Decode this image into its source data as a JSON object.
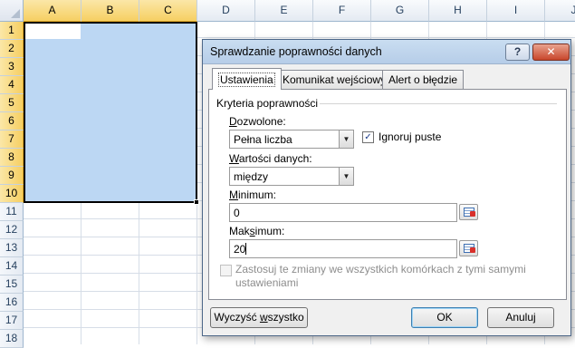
{
  "spreadsheet": {
    "columns": [
      "A",
      "B",
      "C",
      "D",
      "E",
      "F",
      "G",
      "H",
      "I",
      "J"
    ],
    "rows": [
      "1",
      "2",
      "3",
      "4",
      "5",
      "6",
      "7",
      "8",
      "9",
      "10",
      "11",
      "12",
      "13",
      "14",
      "15",
      "16",
      "17",
      "18"
    ],
    "selection_fill": "#bcd7f3"
  },
  "dialog": {
    "title": "Sprawdzanie poprawności danych",
    "help_label": "?",
    "close_label": "✕",
    "tabs": {
      "settings": "Ustawienia",
      "input_message": "Komunikat wejściowy",
      "error_alert": "Alert o błędzie"
    },
    "criteria_label": "Kryteria poprawności",
    "allow": {
      "label_key": "D",
      "label_rest": "ozwolone:",
      "value": "Pełna liczba"
    },
    "ignore_blank": {
      "label_pre": "Ignoru",
      "label_key": "j",
      "label_post": " puste",
      "checked": true,
      "check_mark": "✓"
    },
    "data": {
      "label_key": "W",
      "label_rest": "artości danych:",
      "value": "między"
    },
    "minimum": {
      "label_key": "M",
      "label_rest": "inimum:",
      "value": "0"
    },
    "maximum": {
      "label_pre": "Mak",
      "label_key": "s",
      "label_post": "imum:",
      "value": "20"
    },
    "apply_all": {
      "label": "Zastosuj te zmiany we wszystkich komórkach z tymi samymi ustawieniami",
      "line1": "Zastosuj te zmiany we wszystkich komórkach z tymi samymi",
      "line2": "ustawieniami",
      "enabled": false
    },
    "buttons": {
      "clear_pre": "Wyczyść ",
      "clear_key": "w",
      "clear_post": "szystko",
      "ok": "OK",
      "cancel": "Anuluj"
    },
    "dropdown_arrow": "▼"
  }
}
